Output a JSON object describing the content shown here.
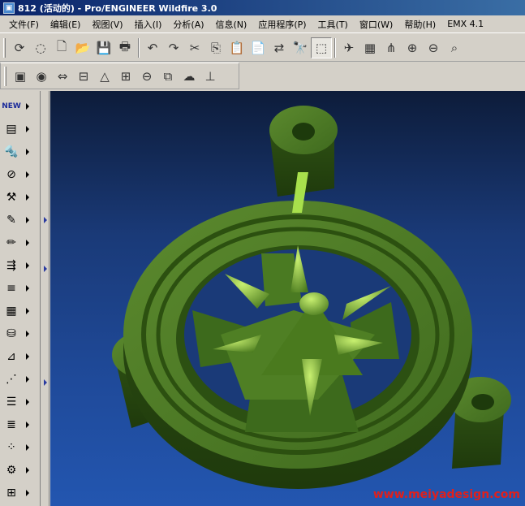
{
  "window": {
    "title": "812 (活动的) - Pro/ENGINEER Wildfire 3.0"
  },
  "menu": [
    "文件(F)",
    "编辑(E)",
    "视图(V)",
    "插入(I)",
    "分析(A)",
    "信息(N)",
    "应用程序(P)",
    "工具(T)",
    "窗口(W)",
    "帮助(H)",
    "EMX 4.1"
  ],
  "toolbar1": [
    {
      "name": "regenerate-icon",
      "glyph": "⟳"
    },
    {
      "name": "erase-icon",
      "glyph": "◌"
    },
    {
      "name": "new-file-icon",
      "glyph": "🗋"
    },
    {
      "name": "open-folder-icon",
      "glyph": "📂"
    },
    {
      "name": "save-icon",
      "glyph": "💾"
    },
    {
      "name": "print-icon",
      "glyph": "🖶"
    },
    {
      "name": "undo-icon",
      "glyph": "↶"
    },
    {
      "name": "redo-icon",
      "glyph": "↷"
    },
    {
      "name": "cut-icon",
      "glyph": "✂"
    },
    {
      "name": "copy-icon",
      "glyph": "⎘"
    },
    {
      "name": "paste-icon",
      "glyph": "📋"
    },
    {
      "name": "paste-special-icon",
      "glyph": "📄"
    },
    {
      "name": "relations-icon",
      "glyph": "⇄"
    },
    {
      "name": "find-icon",
      "glyph": "🔭"
    },
    {
      "name": "select-box-icon",
      "glyph": "⬚"
    },
    {
      "name": "spin-center-icon",
      "glyph": "✈"
    },
    {
      "name": "repaint-icon",
      "glyph": "▦"
    },
    {
      "name": "orient-icon",
      "glyph": "⋔"
    },
    {
      "name": "zoom-in-icon",
      "glyph": "⊕"
    },
    {
      "name": "zoom-out-icon",
      "glyph": "⊖"
    },
    {
      "name": "refit-icon",
      "glyph": "⌕"
    }
  ],
  "toolbar2": [
    {
      "name": "mold-layout-icon",
      "glyph": "▣"
    },
    {
      "name": "color-appearance-icon",
      "glyph": "◉"
    },
    {
      "name": "dimension-icon",
      "glyph": "⇔"
    },
    {
      "name": "plate-icon",
      "glyph": "⊟"
    },
    {
      "name": "triangle-icon",
      "glyph": "△"
    },
    {
      "name": "grid-icon",
      "glyph": "⊞"
    },
    {
      "name": "circle-line-icon",
      "glyph": "⊖"
    },
    {
      "name": "component-icon",
      "glyph": "⧉"
    },
    {
      "name": "cloud-icon",
      "glyph": "☁"
    },
    {
      "name": "ejector-icon",
      "glyph": "⊥"
    }
  ],
  "lefttools": [
    {
      "name": "new-mold-icon",
      "glyph": "NEW"
    },
    {
      "name": "mold-base-icon",
      "glyph": "▤"
    },
    {
      "name": "screw-icon",
      "glyph": "🔩"
    },
    {
      "name": "ejector-pin-icon",
      "glyph": "⊘"
    },
    {
      "name": "bolt-icon",
      "glyph": "⚒"
    },
    {
      "name": "sprue-icon",
      "glyph": "✎"
    },
    {
      "name": "pencil-icon",
      "glyph": "✏"
    },
    {
      "name": "slider-icon",
      "glyph": "⇶"
    },
    {
      "name": "cooling-icon",
      "glyph": "≡"
    },
    {
      "name": "grid-plate-icon",
      "glyph": "▦"
    },
    {
      "name": "database-icon",
      "glyph": "⛁"
    },
    {
      "name": "angle-icon",
      "glyph": "⊿"
    },
    {
      "name": "cut-line-icon",
      "glyph": "⋰"
    },
    {
      "name": "stack-icon",
      "glyph": "☰"
    },
    {
      "name": "list-icon",
      "glyph": "≣"
    },
    {
      "name": "points-icon",
      "glyph": "⁘"
    },
    {
      "name": "gear-icon",
      "glyph": "⚙"
    },
    {
      "name": "add-component-icon",
      "glyph": "⊞"
    }
  ],
  "watermark": "www.meiyadesign.com"
}
